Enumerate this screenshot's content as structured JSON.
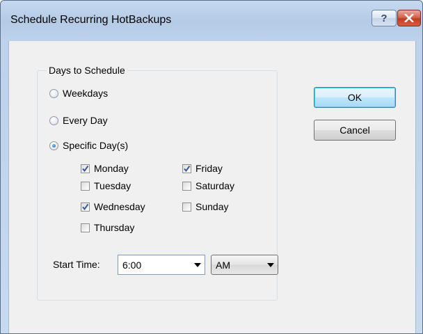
{
  "dialog": {
    "title": "Schedule Recurring HotBackups",
    "help_glyph": "?",
    "close_glyph": "×"
  },
  "group": {
    "legend": "Days to Schedule",
    "radios": [
      {
        "label": "Weekdays",
        "checked": false
      },
      {
        "label": "Every Day",
        "checked": false
      },
      {
        "label": "Specific Day(s)",
        "checked": true
      }
    ],
    "days": [
      {
        "label": "Monday",
        "checked": true
      },
      {
        "label": "Tuesday",
        "checked": false
      },
      {
        "label": "Wednesday",
        "checked": true
      },
      {
        "label": "Thursday",
        "checked": false
      },
      {
        "label": "Friday",
        "checked": true
      },
      {
        "label": "Saturday",
        "checked": false
      },
      {
        "label": "Sunday",
        "checked": false
      }
    ],
    "start_time_label": "Start Time:",
    "start_time_value": "6:00",
    "ampm_value": "AM"
  },
  "buttons": {
    "ok": "OK",
    "cancel": "Cancel"
  },
  "colors": {
    "title_bar": "#c1d5ec",
    "client_bg": "#f0f0f0",
    "check_mark": "#3a5a9b",
    "radio_dot": "#1c5fa8"
  }
}
